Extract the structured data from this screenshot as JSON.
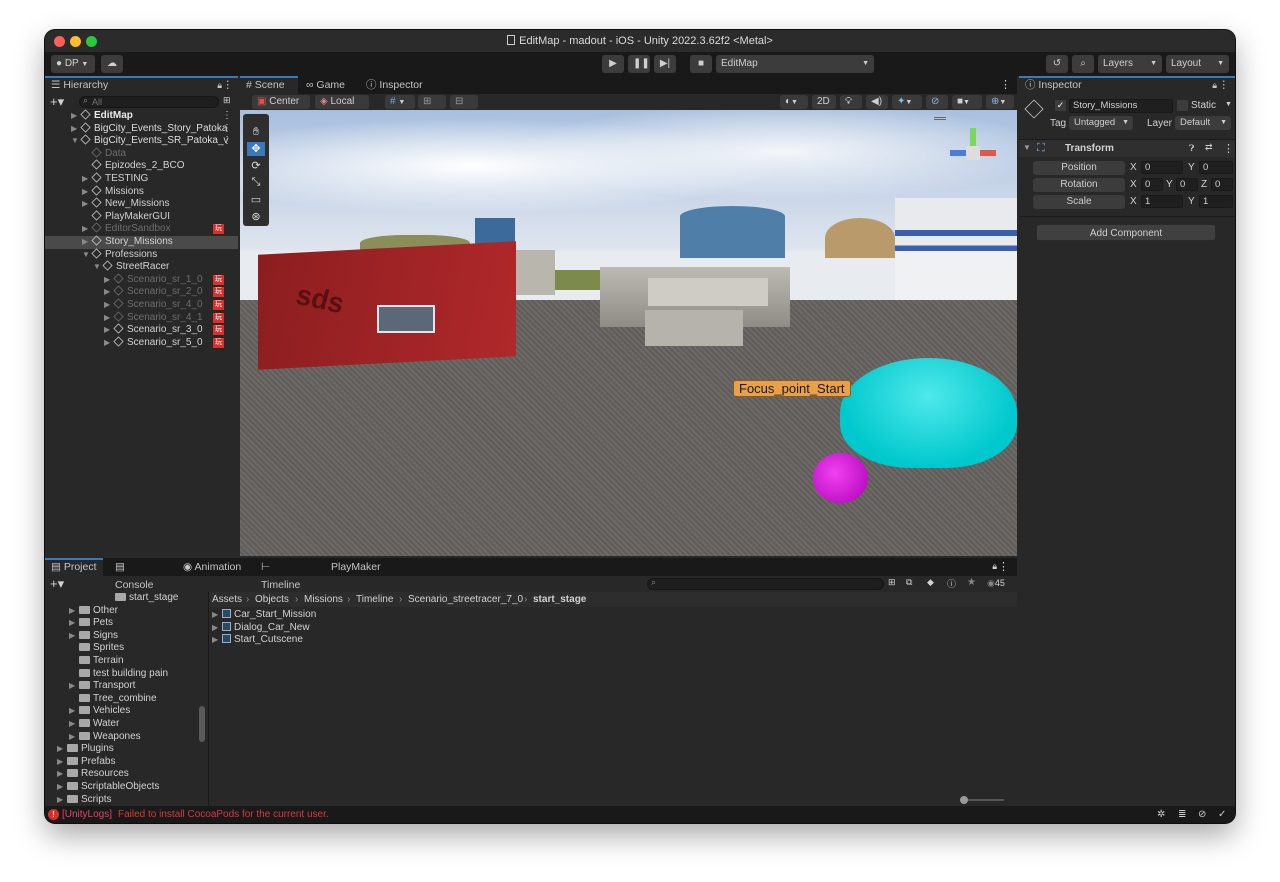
{
  "window": {
    "title": "EditMap - madout - iOS - Unity 2022.3.62f2 <Metal>"
  },
  "toolbar": {
    "account": "DP",
    "scene_select": "EditMap",
    "layers": "Layers",
    "layout": "Layout"
  },
  "hierarchy": {
    "tab": "Hierarchy",
    "search_placeholder": "All",
    "items": [
      {
        "label": "EditMap",
        "indent": 0,
        "arrow": "▶",
        "style": "bold"
      },
      {
        "label": "BigCity_Events_Story_Patoka",
        "indent": 0,
        "arrow": "▶",
        "style": "scene"
      },
      {
        "label": "BigCity_Events_SR_Patoka_v",
        "indent": 0,
        "arrow": "▼",
        "style": "scene"
      },
      {
        "label": "Data",
        "indent": 1,
        "arrow": "",
        "style": "dim"
      },
      {
        "label": "Epizodes_2_BCO",
        "indent": 1,
        "arrow": "",
        "style": "normal"
      },
      {
        "label": "TESTING",
        "indent": 1,
        "arrow": "▶",
        "style": "normal"
      },
      {
        "label": "Missions",
        "indent": 1,
        "arrow": "▶",
        "style": "normal"
      },
      {
        "label": "New_Missions",
        "indent": 1,
        "arrow": "▶",
        "style": "normal"
      },
      {
        "label": "PlayMakerGUI",
        "indent": 1,
        "arrow": "",
        "style": "normal"
      },
      {
        "label": "EditorSandbox",
        "indent": 1,
        "arrow": "▶",
        "style": "dim",
        "badge": "玩"
      },
      {
        "label": "Story_Missions",
        "indent": 1,
        "arrow": "▶",
        "style": "selected"
      },
      {
        "label": "Professions",
        "indent": 1,
        "arrow": "▼",
        "style": "normal"
      },
      {
        "label": "StreetRacer",
        "indent": 2,
        "arrow": "▼",
        "style": "normal"
      },
      {
        "label": "Scenario_sr_1_0",
        "indent": 3,
        "arrow": "▶",
        "style": "dim",
        "badge": "玩"
      },
      {
        "label": "Scenario_sr_2_0",
        "indent": 3,
        "arrow": "▶",
        "style": "dim",
        "badge": "玩"
      },
      {
        "label": "Scenario_sr_4_0",
        "indent": 3,
        "arrow": "▶",
        "style": "dim",
        "badge": "玩"
      },
      {
        "label": "Scenario_sr_4_1",
        "indent": 3,
        "arrow": "▶",
        "style": "dim",
        "badge": "玩"
      },
      {
        "label": "Scenario_sr_3_0",
        "indent": 3,
        "arrow": "▶",
        "style": "normal",
        "badge": "玩"
      },
      {
        "label": "Scenario_sr_5_0",
        "indent": 3,
        "arrow": "▶",
        "style": "normal",
        "badge": "玩"
      }
    ]
  },
  "scene_tabs": [
    {
      "label": "Scene"
    },
    {
      "label": "Game"
    },
    {
      "label": "Inspector"
    }
  ],
  "scene_toolbar": {
    "pivot": "Center",
    "space": "Local",
    "mode_2d": "2D"
  },
  "scene": {
    "label": "Focus_point_Start",
    "container_text": "sds"
  },
  "inspector": {
    "tab": "Inspector",
    "object_name": "Story_Missions",
    "static_label": "Static",
    "tag_label": "Tag",
    "tag_value": "Untagged",
    "layer_label": "Layer",
    "layer_value": "Default",
    "component": "Transform",
    "position": {
      "label": "Position",
      "x": "0",
      "y": "0"
    },
    "rotation": {
      "label": "Rotation",
      "x": "0",
      "y": "0",
      "z": "0"
    },
    "scale": {
      "label": "Scale",
      "x": "1",
      "y": "1"
    },
    "axis": {
      "x": "X",
      "y": "Y",
      "z": "Z"
    },
    "add_component": "Add Component"
  },
  "bottom_tabs": [
    {
      "label": "Project"
    },
    {
      "label": "Console"
    },
    {
      "label": "Animation"
    },
    {
      "label": "Timeline"
    },
    {
      "label": "PlayMaker"
    }
  ],
  "project": {
    "hidden_count": "45",
    "breadcrumb": [
      "Assets",
      "Objects",
      "Missions",
      "Timeline",
      "Scenario_streetracer_7_0",
      "start_stage"
    ],
    "tree": [
      {
        "label": "start_stage",
        "indent": 3,
        "arrow": "",
        "selected": true
      },
      {
        "label": "Other",
        "indent": 1,
        "arrow": "▶"
      },
      {
        "label": "Pets",
        "indent": 1,
        "arrow": "▶"
      },
      {
        "label": "Signs",
        "indent": 1,
        "arrow": "▶"
      },
      {
        "label": "Sprites",
        "indent": 1,
        "arrow": ""
      },
      {
        "label": "Terrain",
        "indent": 1,
        "arrow": ""
      },
      {
        "label": "test building pain",
        "indent": 1,
        "arrow": ""
      },
      {
        "label": "Transport",
        "indent": 1,
        "arrow": "▶"
      },
      {
        "label": "Tree_combine",
        "indent": 1,
        "arrow": ""
      },
      {
        "label": "Vehicles",
        "indent": 1,
        "arrow": "▶"
      },
      {
        "label": "Water",
        "indent": 1,
        "arrow": "▶"
      },
      {
        "label": "Weapones",
        "indent": 1,
        "arrow": "▶"
      },
      {
        "label": "Plugins",
        "indent": 0,
        "arrow": "▶"
      },
      {
        "label": "Prefabs",
        "indent": 0,
        "arrow": "▶"
      },
      {
        "label": "Resources",
        "indent": 0,
        "arrow": "▶"
      },
      {
        "label": "ScriptableObjects",
        "indent": 0,
        "arrow": "▶"
      },
      {
        "label": "Scripts",
        "indent": 0,
        "arrow": "▶"
      }
    ],
    "assets": [
      {
        "label": "Car_Start_Mission"
      },
      {
        "label": "Dialog_Car_New"
      },
      {
        "label": "Start_Cutscene"
      }
    ]
  },
  "status": {
    "tag": "[UnityLogs]",
    "message": "Failed to install CocoaPods for the current user."
  },
  "colors": {
    "accent": "#3a79bb",
    "selection": "#2c5d87",
    "error": "#d9302b",
    "panel": "#282828",
    "toolbar": "#191919"
  }
}
